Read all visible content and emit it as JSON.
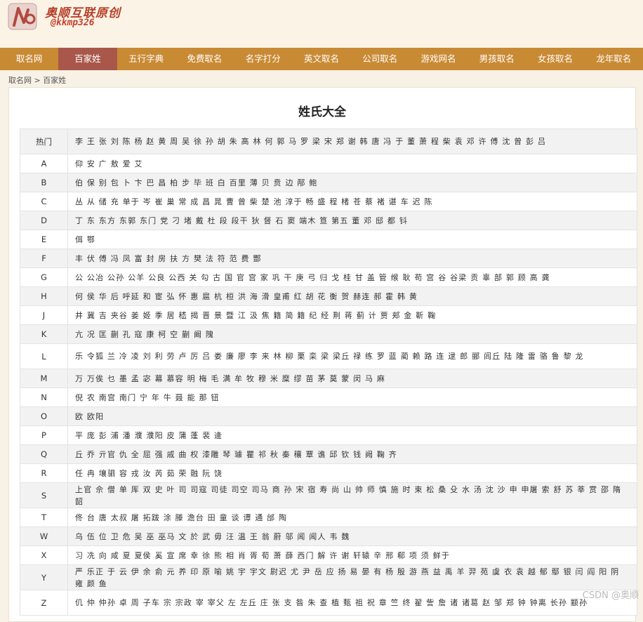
{
  "brand": {
    "name": "奥顺互联原创",
    "handle": "@kkmp326"
  },
  "nav": [
    {
      "label": "取名网",
      "active": false
    },
    {
      "label": "百家姓",
      "active": true
    },
    {
      "label": "五行字典",
      "active": false
    },
    {
      "label": "免费取名",
      "active": false
    },
    {
      "label": "名字打分",
      "active": false
    },
    {
      "label": "英文取名",
      "active": false
    },
    {
      "label": "公司取名",
      "active": false
    },
    {
      "label": "游戏网名",
      "active": false
    },
    {
      "label": "男孩取名",
      "active": false
    },
    {
      "label": "女孩取名",
      "active": false
    },
    {
      "label": "龙年取名",
      "active": false
    }
  ],
  "breadcrumb": {
    "home": "取名网",
    "separator": ">",
    "current": "百家姓"
  },
  "page_title": "姓氏大全",
  "rows": [
    {
      "key": "热门",
      "names": "李 王 张 刘 陈 杨 赵 黄 周 吴 徐 孙 胡 朱 高 林 何 郭 马 罗 梁 宋 郑 谢 韩 唐 冯 于 董 萧 程 柴 袁 邓 许 傅 沈 曾 彭 吕"
    },
    {
      "key": "A",
      "names": "仰 安 广 敖 爱 艾"
    },
    {
      "key": "B",
      "names": "伯 保 别 包 卜 卞 巴 昌 柏 步 毕 班 白 百里 薄 贝 贲 边 邴 鲍"
    },
    {
      "key": "C",
      "names": "丛 从 储 充 单于 岑 崔 巢 常 成 昌 晁 曹 曾 柴 楚 池 淳于 畅 盛 程 楮 苍 蔡 褚 谌 车 迟 陈"
    },
    {
      "key": "D",
      "names": "丁 东 东方 东郭 东门 党 刁 堵 戴 杜 段 段干 狄 督 石 窦 端木 笪 第五 董 邓 邸 都 钭"
    },
    {
      "key": "E",
      "names": "佴 鄂"
    },
    {
      "key": "F",
      "names": "丰 伏 傅 冯 凤 富 封 房 扶 方 樊 法 符 范 费 酆"
    },
    {
      "key": "G",
      "names": "公 公冶 公孙 公羊 公良 公西 关 勾 古 国 官 宫 家 巩 干 庚 弓 归 戈 桂 甘 盖 管 缑 耿 苟 宫 谷 谷梁 贡 辜 部 郭 顾 高 龚"
    },
    {
      "key": "H",
      "names": "何 侯 华 后 呼延 和 宦 弘 怀 惠 扈 杭 桓 洪 海 滑 皇甫 红 胡 花 衡 贺 赫连 郝 霍 韩 黄"
    },
    {
      "key": "J",
      "names": "井 冀 吉 夹谷 姜 姬 季 居 嵇 揭 晋 景 暨 江 汲 焦 籍 简 籍 纪 经 荆 蒋 蓟 计 贾 郏 金 靳 鞠"
    },
    {
      "key": "K",
      "names": "亢 况 匡 蒯 孔 寇 康 柯 空 蒯 阚 隗"
    },
    {
      "key": "L",
      "names": "乐 令狐 兰 冷 凌 刘 利 劳 卢 厉 吕 娄 廉 廖 李 来 林 柳 栗 栾 梁 梁丘 禄 练 罗 蓝 蔺 赖 路 连 逯 郎 郦 闾丘 陆 隆 雷 骆 鲁 黎 龙"
    },
    {
      "key": "M",
      "names": "万 万俟 乜 墨 孟 宓 幕 慕容 明 梅 毛 满 牟 牧 穆 米 糜 缪 苗 茅 莫 蒙 闵 马 麻"
    },
    {
      "key": "N",
      "names": "倪 农 南宫 南门 宁 年 牛 聂 能 那 钮"
    },
    {
      "key": "O",
      "names": "欧 欧阳"
    },
    {
      "key": "P",
      "names": "平 庞 彭 浦 潘 濮 濮阳 皮 蒲 蓬 裴 逄"
    },
    {
      "key": "Q",
      "names": "丘 乔 亓官 仇 全 屈 强 戚 曲 权 漆雕 琴 璩 瞿 祁 秋 秦 穰 覃 谯 邱 钦 钱 阙 鞠 齐"
    },
    {
      "key": "R",
      "names": "任 冉 壤驷 容 戎 汝 芮 茹 荣 融 阮 饶"
    },
    {
      "key": "S",
      "names": "上官 佘 僧 单 厍 双 史 叶 司 司寇 司徒 司空 司马 商 孙 宋 宿 寿 尚 山 帅 师 慎 施 时 束 松 桑 殳 水 汤 沈 沙 申 申屠 索 舒 苏 莘 赏 邵 隋 韶"
    },
    {
      "key": "T",
      "names": "佟 台 唐 太叔 屠 拓跋 涂 滕 澹台 田 童 谈 谭 通 邰 陶"
    },
    {
      "key": "W",
      "names": "乌 伍 位 卫 危 吴 巫 巫马 文 於 武 毋 汪 温 王 翁 蔚 邬 闻 闻人 韦 魏"
    },
    {
      "key": "X",
      "names": "习 冼 向 咸 夏 夏侯 奚 宣 席 幸 徐 熊 相 肖 胥 荀 萧 薛 西门 解 许 谢 轩辕 辛 邢 郗 项 须 鲜于"
    },
    {
      "key": "Y",
      "names": "严 乐正 于 云 伊 余 俞 元 养 印 原 喻 姚 宇 宇文 尉迟 尤 尹 岳 应 扬 易 晏 有 杨 殷 游 燕 益 禹 羊 羿 苑 虞 衣 袁 越 郁 鄢 银 闫 阎 阳 阴 雍 颜 鱼"
    },
    {
      "key": "Z",
      "names": "仉 仲 仲孙 卓 周 子车 宗 宗政 宰 宰父 左 左丘 庄 张 支 昝 朱 查 植 甄 祖 祝 章 竺 终 翟 訾 詹 诸 诸葛 赵 邹 郑 钟 钟离 长孙 颛孙"
    }
  ],
  "watermark": "CSDN @奥顺"
}
